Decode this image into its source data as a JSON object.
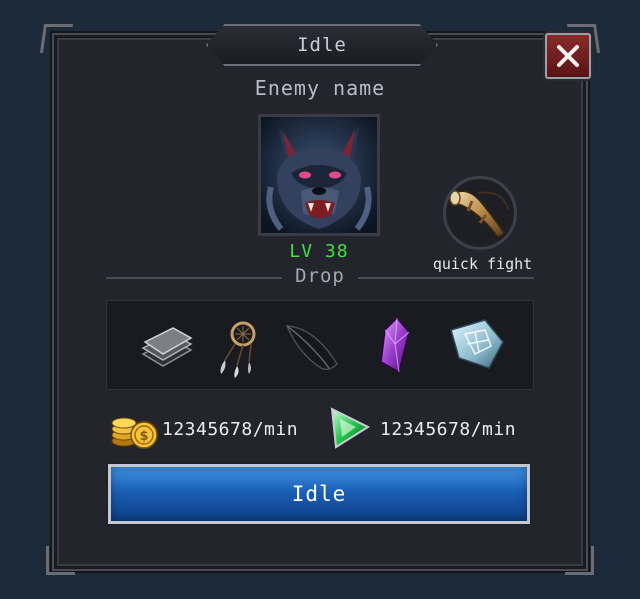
{
  "window": {
    "title": "Idle"
  },
  "enemy": {
    "name": "Enemy name",
    "level": "LV 38"
  },
  "quick_fight": {
    "label": "quick fight",
    "icon": "horn-icon"
  },
  "drop": {
    "label": "Drop",
    "items": [
      "metal-plates-icon",
      "dreamcatcher-icon",
      "black-feather-icon",
      "purple-crystal-icon",
      "rune-stone-icon"
    ]
  },
  "rates": {
    "gold": {
      "icon": "gold-coins-icon",
      "value": "12345678/min"
    },
    "exp": {
      "icon": "green-gem-icon",
      "value": "12345678/min"
    }
  },
  "action_button": {
    "label": "Idle"
  },
  "colors": {
    "level": "#3fe040",
    "button": "#1b5fb6",
    "background": "#1d2a3a"
  }
}
